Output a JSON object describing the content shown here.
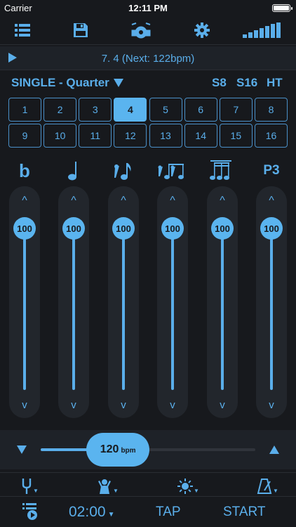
{
  "status_bar": {
    "carrier": "Carrier",
    "time": "12:11 PM"
  },
  "toolbar": {
    "icons": [
      "list-icon",
      "save-icon",
      "drum-kit-icon",
      "gear-icon",
      "volume-bars-icon"
    ]
  },
  "player": {
    "song_label": "7. 4 (Next: 122bpm)"
  },
  "mode": {
    "selected": "SINGLE - Quarter",
    "options": [
      "S8",
      "S16",
      "HT"
    ]
  },
  "beats": {
    "row1": [
      "1",
      "2",
      "3",
      "4",
      "5",
      "6",
      "7",
      "8"
    ],
    "row2": [
      "9",
      "10",
      "11",
      "12",
      "13",
      "14",
      "15",
      "16"
    ],
    "active": "4"
  },
  "subdivisions": {
    "labels": [
      "b",
      "",
      "",
      "",
      "",
      "P3"
    ],
    "icons": [
      "flat-icon",
      "quarter-note-icon",
      "rest-eighth-icon",
      "triplet-icon",
      "sixteenth-notes-icon",
      "p3-label"
    ]
  },
  "sliders": [
    {
      "value": "100",
      "up": "^",
      "down": "v"
    },
    {
      "value": "100",
      "up": "^",
      "down": "v"
    },
    {
      "value": "100",
      "up": "^",
      "down": "v"
    },
    {
      "value": "100",
      "up": "^",
      "down": "v"
    },
    {
      "value": "100",
      "up": "^",
      "down": "v"
    },
    {
      "value": "100",
      "up": "^",
      "down": "v"
    }
  ],
  "tempo": {
    "value": "120",
    "unit": "bpm",
    "fraction": 0.36
  },
  "tools": [
    "tuning-fork-icon",
    "conductor-icon",
    "brightness-icon",
    "metronome-icon"
  ],
  "bottom": {
    "timer": "02:00",
    "tap": "TAP",
    "start": "START"
  },
  "colors": {
    "accent": "#5ab4ef",
    "background": "#17191d"
  }
}
